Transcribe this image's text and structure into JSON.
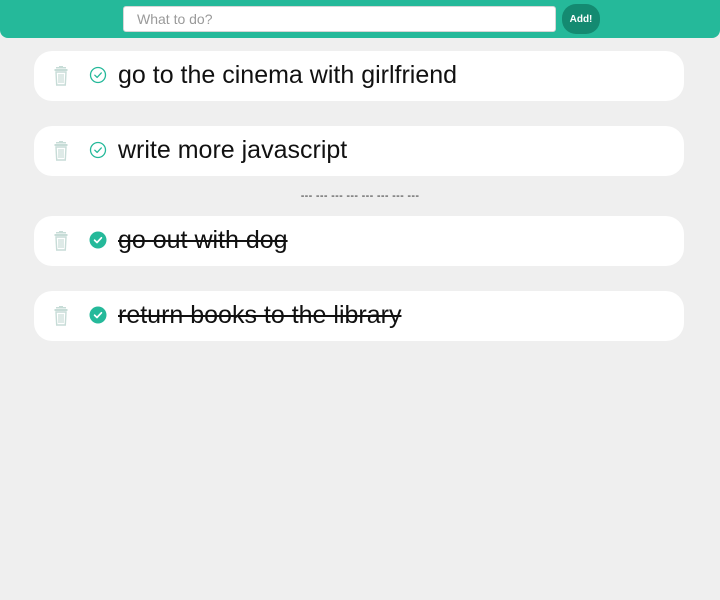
{
  "header": {
    "input_placeholder": "What to do?",
    "input_value": "",
    "add_button_label": "Add!"
  },
  "todos": [
    {
      "text": "go to the cinema with girlfriend",
      "completed": false
    },
    {
      "text": "write more javascript",
      "completed": false
    }
  ],
  "separator": "--- --- --- --- --- --- --- ---",
  "completed_todos": [
    {
      "text": "go out with dog",
      "completed": true
    },
    {
      "text": "return books to the library",
      "completed": true
    }
  ],
  "icons": {
    "delete": "trash-icon",
    "toggle_pending": "check-circle-outline-icon",
    "toggle_done": "check-circle-filled-icon"
  },
  "colors": {
    "accent": "#25b99a",
    "button": "#148a71",
    "background": "#efefef",
    "card": "#ffffff",
    "trash_icon": "#c7dcd7"
  }
}
